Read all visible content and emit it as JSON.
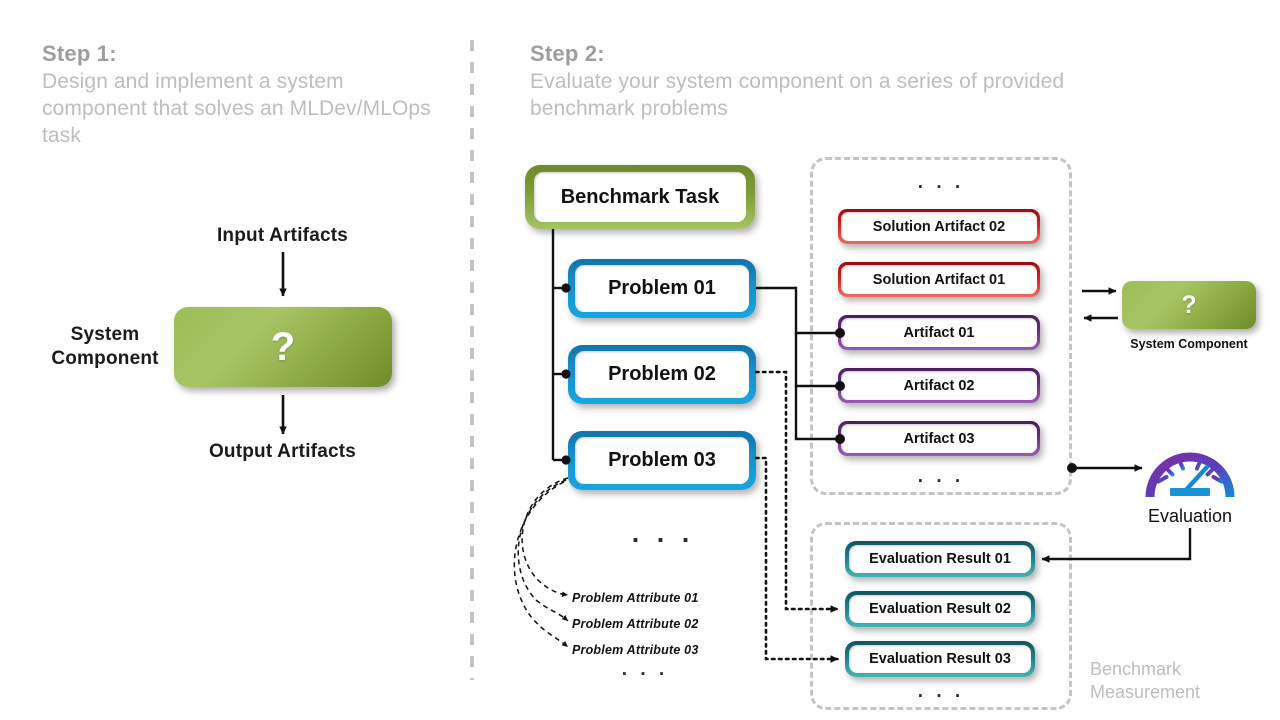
{
  "step1": {
    "title": "Step 1:",
    "description": "Design and implement a system component that solves an MLDev/MLOps task",
    "input_label": "Input Artifacts",
    "output_label": "Output Artifacts",
    "component_label": "System\nComponent",
    "component_label_line1": "System",
    "component_label_line2": "Component",
    "component_symbol": "?"
  },
  "step2": {
    "title": "Step 2:",
    "description": "Evaluate your system component on a series of provided benchmark problems",
    "benchmark_task": "Benchmark Task",
    "problems": [
      {
        "label": "Problem 01"
      },
      {
        "label": "Problem 02"
      },
      {
        "label": "Problem 03"
      }
    ],
    "problems_ellipsis": ". . .",
    "problem_attributes": [
      "Problem Attribute  01",
      "Problem Attribute  02",
      "Problem Attribute  03"
    ],
    "problem_attributes_ellipsis": ". . .",
    "artifacts_group": {
      "top_ellipsis": ". . .",
      "bottom_ellipsis": ". . .",
      "solution_artifacts": [
        {
          "label": "Solution Artifact 02"
        },
        {
          "label": "Solution Artifact 01"
        }
      ],
      "artifacts": [
        {
          "label": "Artifact 01"
        },
        {
          "label": "Artifact 02"
        },
        {
          "label": "Artifact 03"
        }
      ]
    },
    "system_component": {
      "symbol": "?",
      "caption": "System Component"
    },
    "evaluation": {
      "caption": "Evaluation",
      "icon": "gauge-icon"
    },
    "measurement_group": {
      "results": [
        {
          "label": "Evaluation Result 01"
        },
        {
          "label": "Evaluation Result 02"
        },
        {
          "label": "Evaluation Result 03"
        }
      ],
      "bottom_ellipsis": ". . .",
      "caption_line1": "Benchmark",
      "caption_line2": "Measurement"
    }
  },
  "colors": {
    "heading_title": "#9d9d9d",
    "heading_desc": "#bdbdbd",
    "divider": "#c4c4c4",
    "green_dark": "#6f8c28",
    "green_light": "#a8c566",
    "blue_dark": "#1273aa",
    "blue_light": "#17a6e0",
    "red_dark": "#9c0c0c",
    "red_light": "#f26a62",
    "purple_dark": "#4a1d5e",
    "purple_light": "#9a5bb4",
    "teal_dark": "#13535c",
    "teal_light": "#44b3b3",
    "wire": "#111111"
  }
}
